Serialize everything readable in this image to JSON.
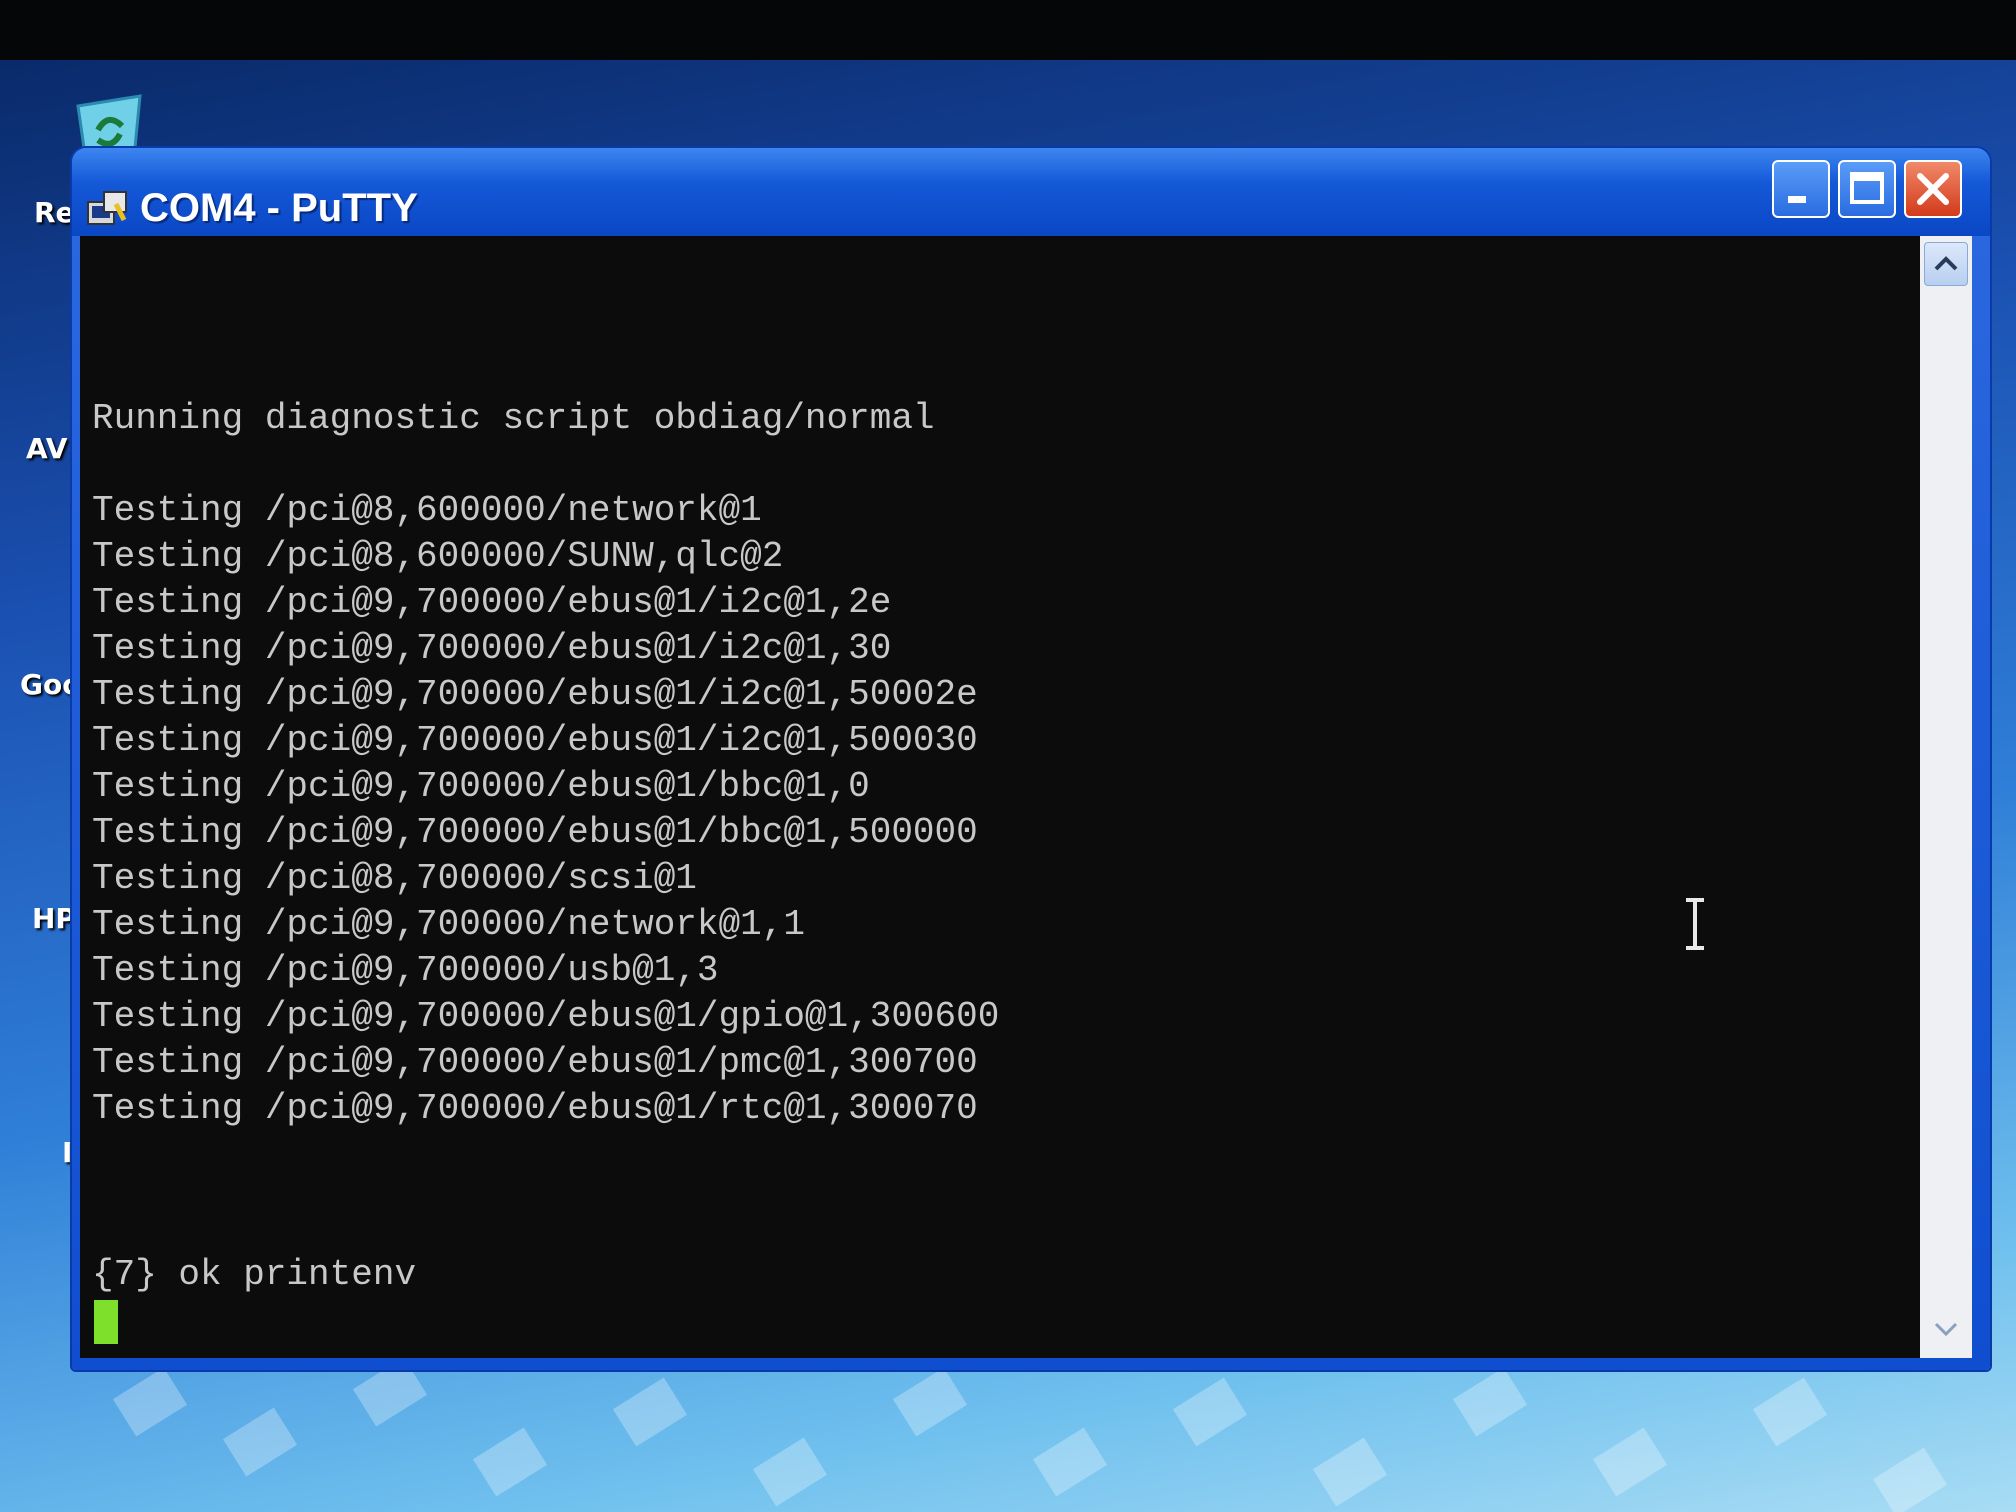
{
  "window": {
    "title": "COM4 - PuTTY"
  },
  "desktop": {
    "icons": [
      {
        "label": "Re"
      },
      {
        "label": "AV("
      },
      {
        "label": "Goo"
      },
      {
        "label": "HP"
      },
      {
        "label": "Ir"
      }
    ]
  },
  "terminal": {
    "lines": [
      "Running diagnostic script obdiag/normal",
      "",
      "Testing /pci@8,600000/network@1",
      "Testing /pci@8,600000/SUNW,qlc@2",
      "Testing /pci@9,700000/ebus@1/i2c@1,2e",
      "Testing /pci@9,700000/ebus@1/i2c@1,30",
      "Testing /pci@9,700000/ebus@1/i2c@1,50002e",
      "Testing /pci@9,700000/ebus@1/i2c@1,500030",
      "Testing /pci@9,700000/ebus@1/bbc@1,0",
      "Testing /pci@9,700000/ebus@1/bbc@1,500000",
      "Testing /pci@8,700000/scsi@1",
      "Testing /pci@9,700000/network@1,1",
      "Testing /pci@9,700000/usb@1,3",
      "Testing /pci@9,700000/ebus@1/gpio@1,300600",
      "Testing /pci@9,700000/ebus@1/pmc@1,300700",
      "Testing /pci@9,700000/ebus@1/rtc@1,300070"
    ],
    "prompt": "{7} ok printenv",
    "cursor_color": "#7ee02a"
  },
  "colors": {
    "titlebar": "#0a47c4",
    "terminal_bg": "#0c0c0c",
    "terminal_fg": "#c8c8c8",
    "close_button": "#d23a1a"
  },
  "icons": {
    "app": "putty-icon",
    "minimize": "minimize-icon",
    "maximize": "maximize-icon",
    "close": "close-icon",
    "recycle": "recycle-bin-icon",
    "scroll_up": "chevron-up-icon",
    "scroll_down": "chevron-down-icon",
    "text_cursor": "ibeam-cursor-icon"
  }
}
